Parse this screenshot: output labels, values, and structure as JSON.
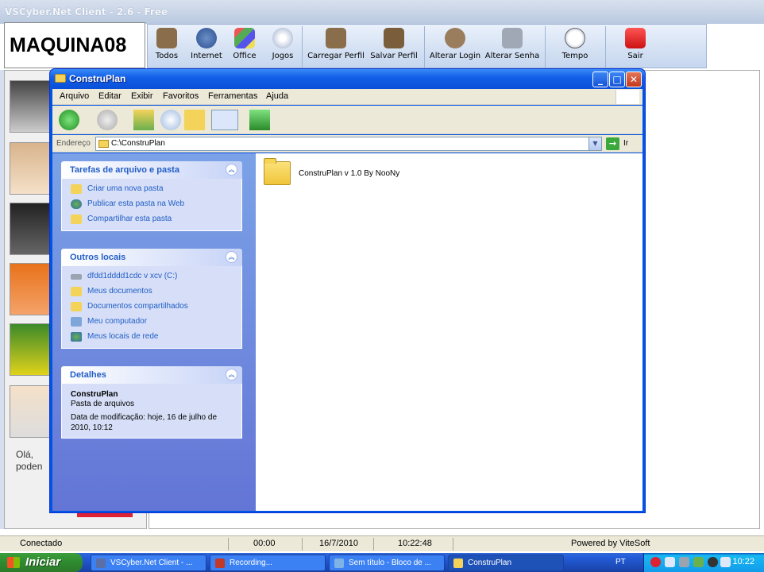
{
  "app": {
    "title": "VSCyber.Net Client - 2.6 - Free",
    "machine": "MAQUINA08",
    "toolbar": [
      {
        "label": "Todos",
        "icon": "folder-stack-icon"
      },
      {
        "label": "Internet",
        "icon": "globe-icon"
      },
      {
        "label": "Office",
        "icon": "office-icon"
      },
      {
        "label": "Jogos",
        "icon": "disc-icon"
      },
      {
        "label": "Carregar Perfil",
        "icon": "load-profile-icon"
      },
      {
        "label": "Salvar Perfil",
        "icon": "save-profile-icon"
      },
      {
        "label": "Alterar Login",
        "icon": "users-icon"
      },
      {
        "label": "Alterar Senha",
        "icon": "keys-icon"
      },
      {
        "label": "Tempo",
        "icon": "clock-icon"
      },
      {
        "label": "Sair",
        "icon": "power-icon"
      }
    ],
    "greeting": [
      "Olá,",
      "poden"
    ]
  },
  "status": {
    "connection": "Conectado",
    "elapsed": "00:00",
    "date": "16/7/2010",
    "time": "10:22:48",
    "powered": "Powered by ViteSoft"
  },
  "explorer": {
    "title": "ConstruPlan",
    "menu": [
      "Arquivo",
      "Editar",
      "Exibir",
      "Favoritos",
      "Ferramentas",
      "Ajuda"
    ],
    "address_label": "Endereço",
    "address_value": "C:\\ConstruPlan",
    "go_label": "Ir",
    "panels": {
      "tasks": {
        "title": "Tarefas de arquivo e pasta",
        "items": [
          "Criar uma nova pasta",
          "Publicar esta pasta na Web",
          "Compartilhar esta pasta"
        ]
      },
      "places": {
        "title": "Outros locais",
        "items": [
          "dfdd1dddd1cdc v xcv (C:)",
          "Meus documentos",
          "Documentos compartilhados",
          "Meu computador",
          "Meus locais de rede"
        ]
      },
      "details": {
        "title": "Detalhes",
        "name": "ConstruPlan",
        "type": "Pasta de arquivos",
        "modified_line1": "Data de modificação: hoje, 16 de julho de",
        "modified_line2": "2010, 10:12"
      }
    },
    "files": [
      {
        "name": "ConstruPlan v 1.0 By NooNy",
        "icon": "folder-icon"
      }
    ]
  },
  "taskbar": {
    "start": "Iniciar",
    "tasks": [
      {
        "label": "VSCyber.Net Client - ...",
        "icon_color": "#5a6fa8"
      },
      {
        "label": "Recording...",
        "icon_color": "#c0392b"
      },
      {
        "label": "Sem título - Bloco de ...",
        "icon_color": "#7fb3e6"
      },
      {
        "label": "ConstruPlan",
        "icon_color": "#f4d35a"
      }
    ],
    "lang": "PT",
    "clock": "10:22"
  },
  "colors": {
    "xp_blue": "#0054e3",
    "task_link": "#215dc6",
    "task_pane": "#6375d6",
    "start_green": "#2f8a2f"
  }
}
